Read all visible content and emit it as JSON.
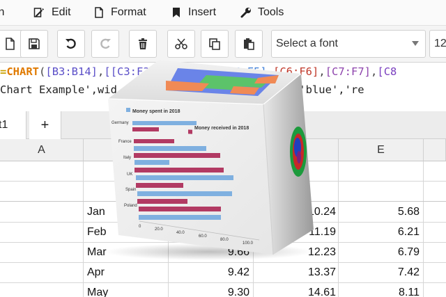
{
  "menu": {
    "items": [
      {
        "label": "in",
        "icon": "none"
      },
      {
        "label": "Edit",
        "icon": "edit-icon"
      },
      {
        "label": "Format",
        "icon": "document-icon"
      },
      {
        "label": "Insert",
        "icon": "bookmark-icon"
      },
      {
        "label": "Tools",
        "icon": "wrench-icon"
      }
    ]
  },
  "toolbar": {
    "buttons": [
      "new-file-icon",
      "save-icon",
      "undo-icon",
      "redo-icon",
      "delete-icon",
      "cut-icon",
      "copy-icon",
      "paste-icon"
    ],
    "font_select": {
      "value": "Select a font"
    },
    "font_size": {
      "value": "12"
    }
  },
  "formula": {
    "line1": {
      "op": "=",
      "fn": "CHART",
      "open": "(",
      "r1": "[B3:B14]",
      "sep1": ",",
      "r2": "[[C3:F3]",
      "gap": "          ",
      "r3": "[C5:F5]",
      "sep2": ",",
      "r4": "[C6:F6]",
      "sep3": ",",
      "r5": "[C7:F7]",
      "sep4": ",",
      "r6": "[C8"
    },
    "line2": {
      "start": "Chart Example',wid",
      "gap": "                    ",
      "end": "['pink','blue','re"
    }
  },
  "sheet_tabs": {
    "active": "t1",
    "add_label": "+"
  },
  "grid": {
    "columns": [
      "A",
      "",
      "",
      "",
      "E"
    ],
    "rows": [
      {
        "month": "Jan",
        "d": "10.24",
        "e": "5.68"
      },
      {
        "month": "Feb",
        "d": "11.19",
        "e": "6.21"
      },
      {
        "month": "Mar",
        "c": "9.66",
        "d": "12.23",
        "e": "6.79"
      },
      {
        "month": "Apr",
        "c": "9.42",
        "d": "13.37",
        "e": "7.42"
      },
      {
        "month": "May",
        "c": "9.30",
        "d": "14.61",
        "e": "8.11"
      }
    ]
  },
  "cube_chart": {
    "legend": [
      "Money spent in 2018",
      "Money received in 2018"
    ],
    "categories": [
      "Germany",
      "France",
      "Italy",
      "UK",
      "Spain",
      "Poland"
    ],
    "x_ticks": [
      "0",
      "20.0",
      "40.0",
      "60.0",
      "80.0",
      "100.0"
    ],
    "colors": {
      "spent": "#7fb0e0",
      "received": "#b23a63",
      "surface_green": "#5cc36a",
      "surface_blue": "#6a84e8",
      "surface_orange": "#f08a55"
    }
  }
}
